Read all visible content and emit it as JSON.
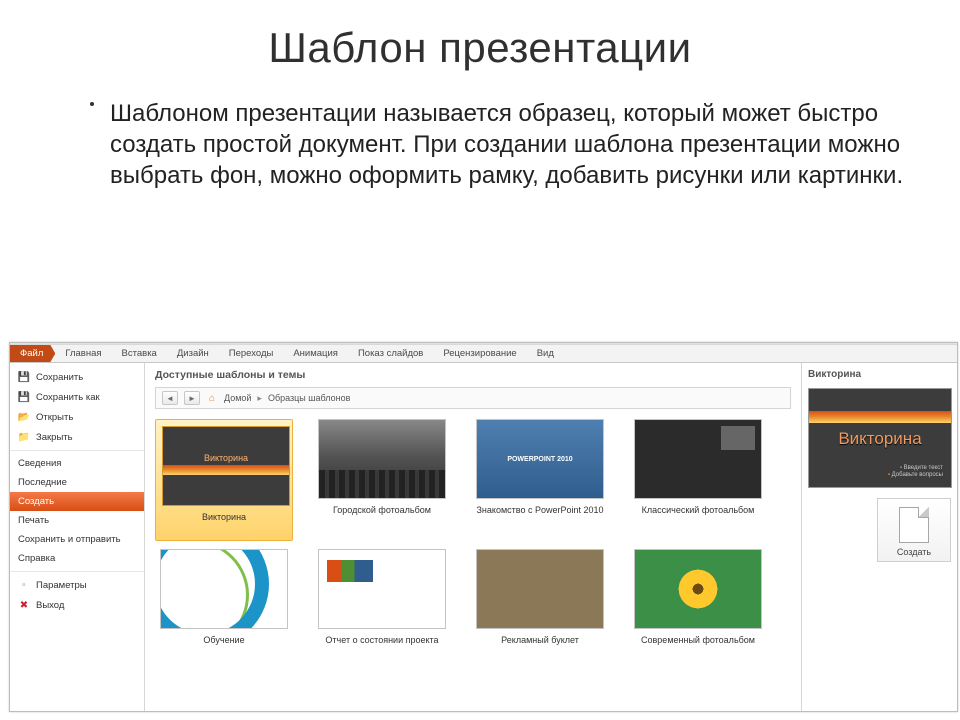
{
  "slide": {
    "title": "Шаблон презентации",
    "body": "Шаблоном презентации называется образец, который может быстро создать простой документ. При создании шаблона презентации можно выбрать фон, можно оформить рамку, добавить рисунки или картинки."
  },
  "ribbon_tabs": {
    "file": "Файл",
    "items": [
      "Главная",
      "Вставка",
      "Дизайн",
      "Переходы",
      "Анимация",
      "Показ слайдов",
      "Рецензирование",
      "Вид"
    ]
  },
  "file_menu": {
    "save": "Сохранить",
    "save_as": "Сохранить как",
    "open": "Открыть",
    "close": "Закрыть",
    "info": "Сведения",
    "recent": "Последние",
    "new": "Создать",
    "print": "Печать",
    "share": "Сохранить и отправить",
    "help": "Справка",
    "options": "Параметры",
    "exit": "Выход"
  },
  "center": {
    "section_title": "Доступные шаблоны и темы",
    "breadcrumb": {
      "home_label": "Домой",
      "current": "Образцы шаблонов"
    }
  },
  "templates": [
    {
      "label": "Викторина",
      "thumb_text": "Викторина"
    },
    {
      "label": "Городской фотоальбом"
    },
    {
      "label": "Знакомство с PowerPoint 2010",
      "thumb_text": "POWERPOINT 2010"
    },
    {
      "label": "Классический фотоальбом"
    },
    {
      "label": "Обучение"
    },
    {
      "label": "Отчет о состоянии проекта"
    },
    {
      "label": "Рекламный буклет"
    },
    {
      "label": "Современный фотоальбом"
    }
  ],
  "preview": {
    "title": "Викторина",
    "slide_text": "Викторина",
    "sub1": "Введите текст",
    "sub2": "Добавьте вопросы",
    "create_label": "Создать"
  }
}
